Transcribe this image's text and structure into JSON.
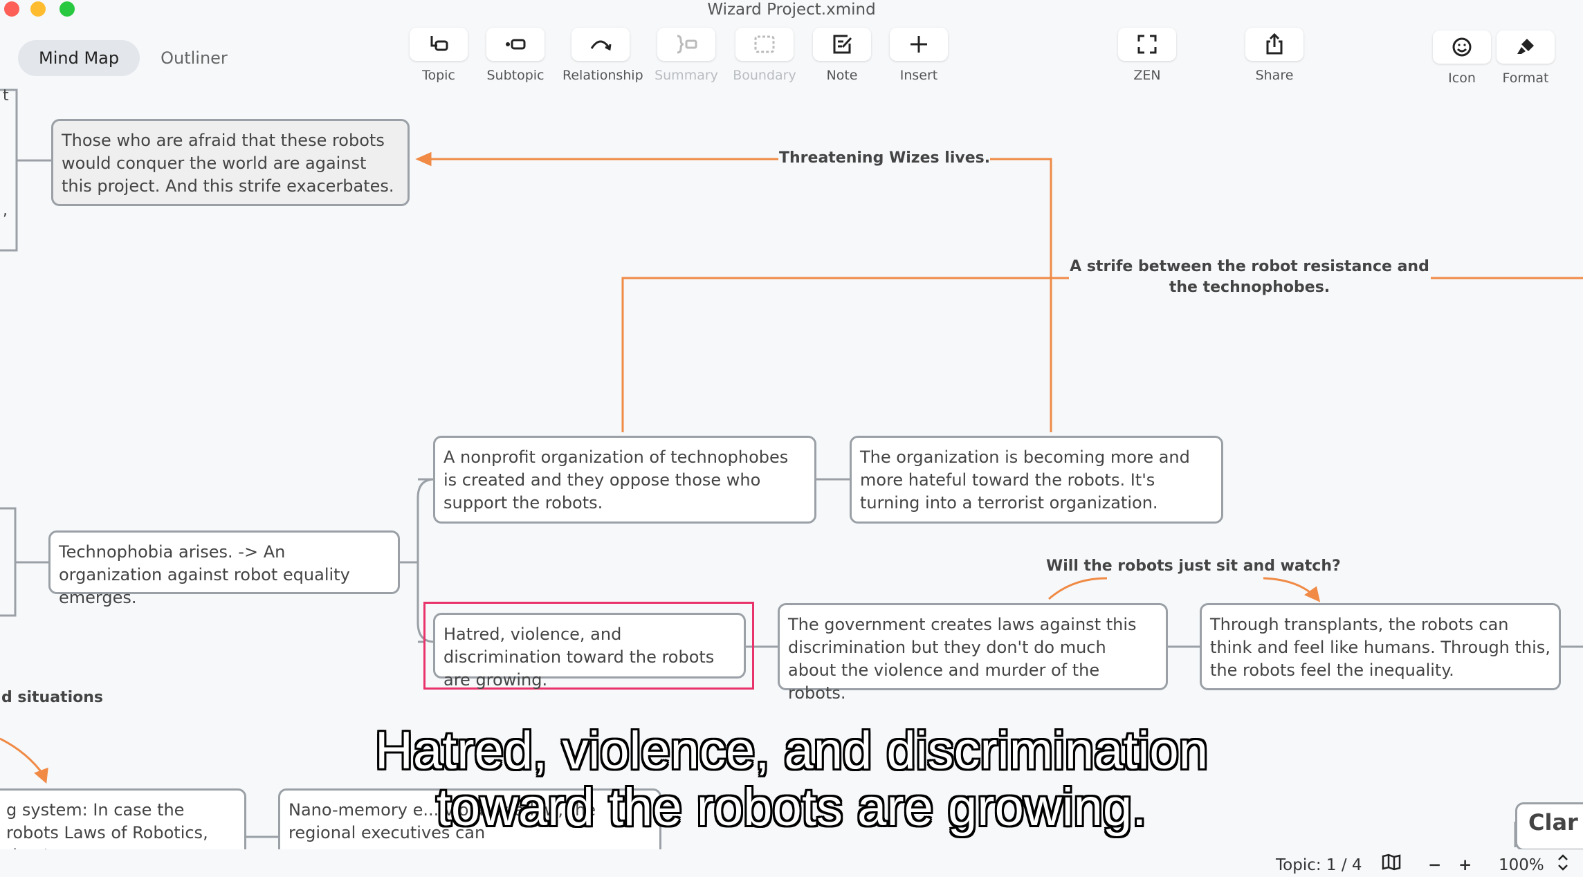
{
  "window": {
    "title": "Wizard Project.xmind"
  },
  "view_switch": {
    "mind_map": "Mind Map",
    "outliner": "Outliner"
  },
  "toolbar": {
    "topic": "Topic",
    "subtopic": "Subtopic",
    "relationship": "Relationship",
    "summary": "Summary",
    "boundary": "Boundary",
    "note": "Note",
    "insert": "Insert",
    "zen": "ZEN",
    "share": "Share",
    "icon": "Icon",
    "format": "Format"
  },
  "map": {
    "edge_fragment_t": "t",
    "edge_fragment_comma": ",",
    "edge_label_situations": "d situations",
    "topics": {
      "afraid": "Those who are afraid that these robots would conquer the world are against this project. And this strife exacerbates.",
      "nonprofit": "A nonprofit organization of technophobes is created and they oppose those who support the robots.",
      "organization": "The organization is becoming more and more hateful toward the robots. It's turning into a terrorist organization.",
      "technophobia": "Technophobia arises. -> An organization against robot equality emerges.",
      "hatred": "Hatred, violence, and discrimination toward the robots are growing.",
      "government": "The government creates laws against this discrimination but they don't do much about the violence and murder of the robots.",
      "transplants": "Through transplants, the robots can think and feel like humans. Through this, the robots feel the inequality.",
      "system_partial": "g system: In case the robots Laws of Robotics, they've",
      "nano_partial": "Nano-memory e... violates a law, the regional executives can",
      "clar_partial": "Clar"
    },
    "relationships": {
      "threatening": "Threatening Wizes lives.",
      "strife": "A strife between the robot resistance and the technophobes.",
      "will_robots": "Will the robots just sit and watch?"
    },
    "connector_color": "#f08a45",
    "selection_color": "#e8336b"
  },
  "subtitle": {
    "line1": "Hatred, violence, and discrimination",
    "line2": "toward the robots are growing."
  },
  "status": {
    "topic_count": "Topic: 1 / 4",
    "zoom": "100%"
  }
}
